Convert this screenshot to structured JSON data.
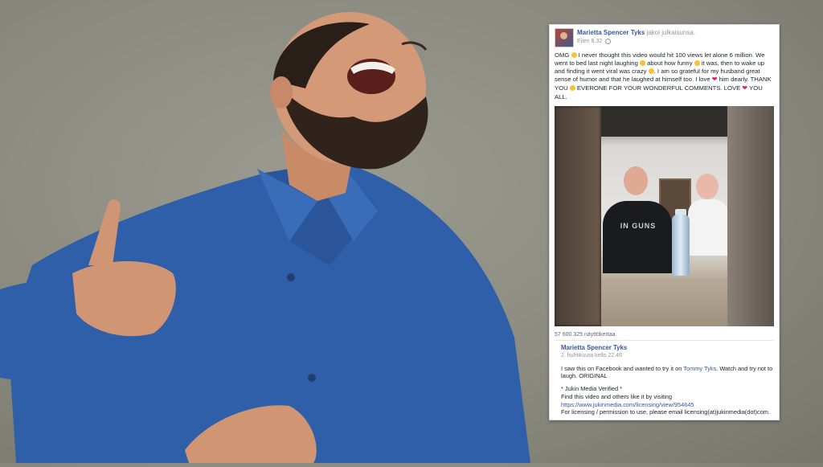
{
  "post": {
    "author": "Marietta Spencer Tyks",
    "action": "jakoi julkaisunsa.",
    "time": "Eilen 8.32",
    "text_parts": [
      "OMG ",
      " I never thought this video would hit 100 views let alone 6 million. We went to bed last night laughing ",
      " about how funny ",
      " it was, then to wake up and finding it went viral was crazy ",
      ". I am so grateful for my husband great sense of humor and that he laughed at himself too. I love ",
      " him dearly. THANK YOU ",
      " EVERONE FOR YOUR WONDERFUL COMMENTS. LOVE ",
      " YOU ALL."
    ],
    "views": "57 600 325 näyttökertaa"
  },
  "video": {
    "shirt_text": "IN GUNS"
  },
  "shared_post": {
    "author": "Marietta Spencer Tyks",
    "time": "2. huhtikuuta kello 22.46",
    "desc_part1": "I saw this on Facebook and wanted to try it on ",
    "desc_link": "Tommy Tyks",
    "desc_part2": ". Watch and try not to laugh. ORIGINAL",
    "verified": "* Jukin Media Verified *",
    "find_line": "Find this video and others like it by visiting",
    "url": "https://www.jukinmedia.com/licensing/view/954645",
    "licensing": "For licensing / permission to use, please email licensing(at)jukinmedia(dot)com."
  },
  "colors": {
    "fb_link": "#365899",
    "shirt_blue": "#2f5fa8",
    "background": "#8f8e84"
  }
}
